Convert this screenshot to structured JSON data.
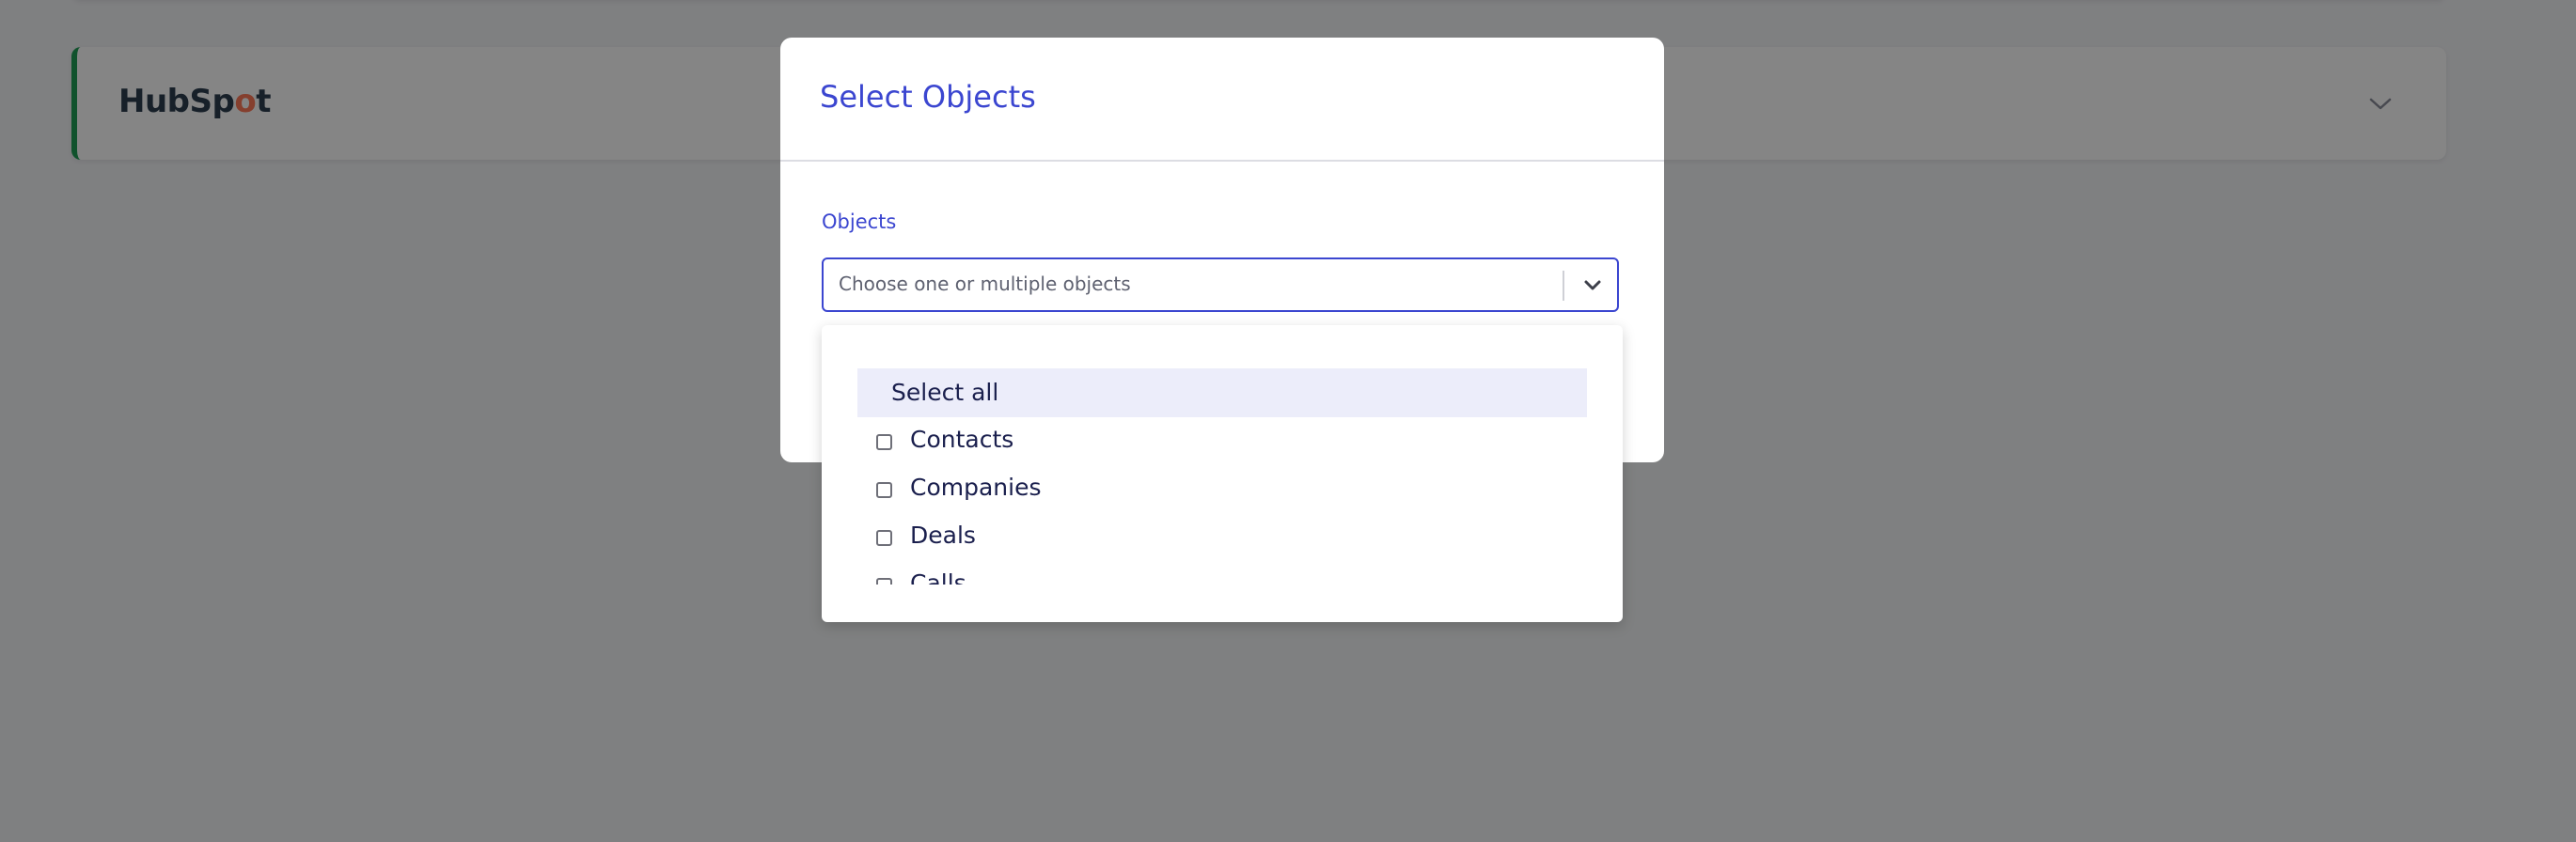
{
  "background": {
    "integration": {
      "logo_text_prefix": "HubSp",
      "logo_text_sprocket": "o",
      "logo_text_suffix": "t",
      "chevron_icon": "chevron-down-icon"
    }
  },
  "modal": {
    "title": "Select Objects",
    "objects_label": "Objects",
    "select": {
      "placeholder": "Choose one or multiple objects",
      "chevron_icon": "chevron-down-icon"
    }
  },
  "dropdown": {
    "select_all_label": "Select all",
    "options": [
      {
        "label": "Contacts",
        "checked": false
      },
      {
        "label": "Companies",
        "checked": false
      },
      {
        "label": "Deals",
        "checked": false
      },
      {
        "label": "Calls",
        "checked": false
      }
    ]
  },
  "colors": {
    "accent": "#3b46d0",
    "card_border": "#1f9d55",
    "hubspot_orange": "#ff7a59"
  }
}
